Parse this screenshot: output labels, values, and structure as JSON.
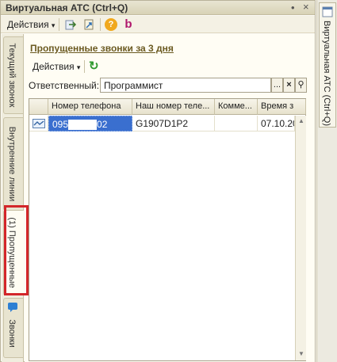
{
  "window": {
    "title": "Виртуальная АТС (Ctrl+Q)"
  },
  "toolbar": {
    "actions_label": "Действия",
    "actions_arrow": "▾",
    "help_symbol": "?",
    "brand_letter": "b",
    "menu_dot": "•",
    "close_symbol": "×"
  },
  "tabs": [
    {
      "label": "Текущий звонок"
    },
    {
      "label": "Внутренние линии"
    },
    {
      "label": "(1) Пропущенные"
    },
    {
      "label": "Звонки"
    }
  ],
  "section": {
    "title": "Пропущенные звонки за 3 дня"
  },
  "sub_toolbar": {
    "actions_label": "Действия",
    "actions_arrow": "▾",
    "refresh_symbol": "↻"
  },
  "filter": {
    "label": "Ответственный:",
    "value": "Программист",
    "choose_symbol": "...",
    "clear_symbol": "×",
    "search_symbol": "⚲"
  },
  "table": {
    "columns": [
      "Номер телефона",
      "Наш номер теле...",
      "Комме...",
      "Время з"
    ],
    "rows": [
      {
        "phone_start": "095",
        "phone_end": "02",
        "our_number": "G1907D1P2",
        "comment": "",
        "time": "07.10.20"
      }
    ]
  },
  "right_dock": {
    "tab_label": "Виртуальная АТС (Ctrl+Q)"
  }
}
